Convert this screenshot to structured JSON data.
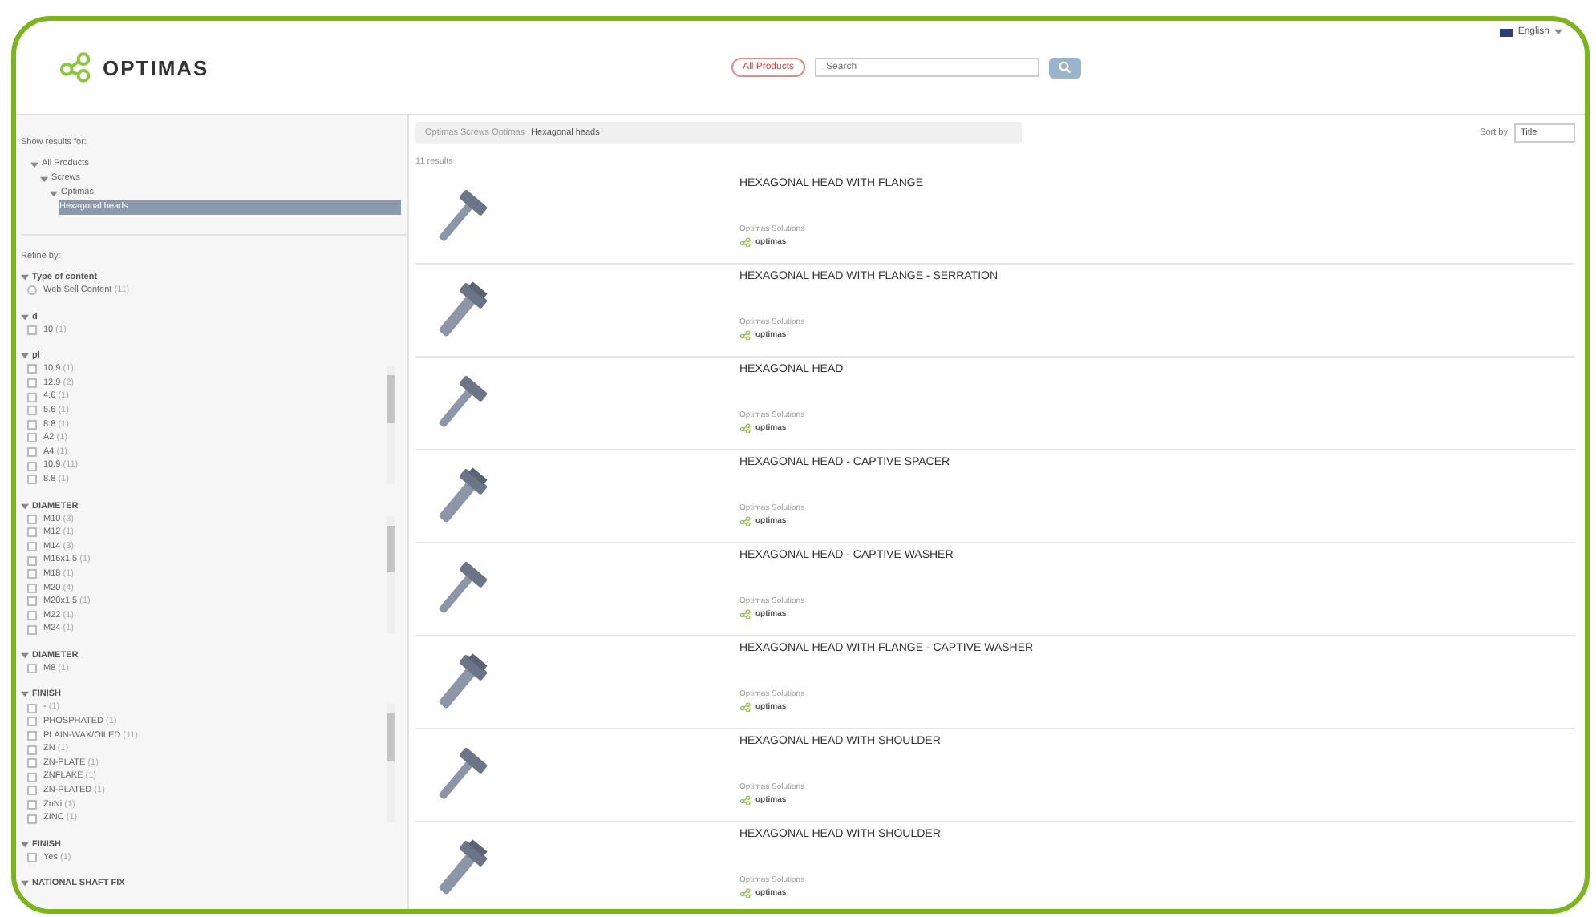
{
  "header": {
    "logo_text": "OPTIMAS",
    "search": {
      "scope": "All Products",
      "placeholder": "Search"
    },
    "language": "English"
  },
  "sidebar": {
    "show_results_label": "Show results for:",
    "tree": [
      {
        "label": "All Products",
        "selected": false,
        "children": [
          {
            "label": "Screws",
            "selected": false,
            "children": [
              {
                "label": "Optimas",
                "selected": false,
                "children": [
                  {
                    "label": "Hexagonal heads",
                    "selected": true
                  }
                ]
              }
            ]
          }
        ]
      }
    ],
    "refine_label": "Refine by:",
    "facets": [
      {
        "title": "Type of content",
        "kind": "radio",
        "items": [
          {
            "label": "Web Sell Content",
            "count": "(11)",
            "checked": false
          }
        ]
      },
      {
        "title": "d",
        "kind": "checkbox",
        "items": [
          {
            "label": "10",
            "count": "(1)",
            "checked": false
          }
        ]
      },
      {
        "title": "pl",
        "kind": "checkbox",
        "scrollable": true,
        "items": [
          {
            "label": "10.9",
            "count": "(1)",
            "checked": false
          },
          {
            "label": "12.9",
            "count": "(2)",
            "checked": false
          },
          {
            "label": "4.6",
            "count": "(1)",
            "checked": false
          },
          {
            "label": "5.6",
            "count": "(1)",
            "checked": false
          },
          {
            "label": "8.8",
            "count": "(1)",
            "checked": false
          },
          {
            "label": "A2",
            "count": "(1)",
            "checked": false
          },
          {
            "label": "A4",
            "count": "(1)",
            "checked": false
          },
          {
            "label": "10.9",
            "count": "(11)",
            "checked": false
          },
          {
            "label": "8.8",
            "count": "(1)",
            "checked": false
          }
        ]
      },
      {
        "title": "DIAMETER",
        "kind": "checkbox",
        "scrollable": true,
        "items": [
          {
            "label": "M10",
            "count": "(3)",
            "checked": false
          },
          {
            "label": "M12",
            "count": "(1)",
            "checked": false
          },
          {
            "label": "M14",
            "count": "(3)",
            "checked": false
          },
          {
            "label": "M16x1.5",
            "count": "(1)",
            "checked": false
          },
          {
            "label": "M18",
            "count": "(1)",
            "checked": false
          },
          {
            "label": "M20",
            "count": "(4)",
            "checked": false
          },
          {
            "label": "M20x1.5",
            "count": "(1)",
            "checked": false
          },
          {
            "label": "M22",
            "count": "(1)",
            "checked": false
          },
          {
            "label": "M24",
            "count": "(1)",
            "checked": false
          }
        ]
      },
      {
        "title": "DIAMETER",
        "kind": "checkbox",
        "items": [
          {
            "label": "M8",
            "count": "(1)",
            "checked": false
          }
        ]
      },
      {
        "title": "FINISH",
        "kind": "checkbox",
        "scrollable": true,
        "items": [
          {
            "label": "-",
            "count": "(1)",
            "checked": false
          },
          {
            "label": "PHOSPHATED",
            "count": "(1)",
            "checked": false
          },
          {
            "label": "PLAIN-WAX/OILED",
            "count": "(11)",
            "checked": false
          },
          {
            "label": "ZN",
            "count": "(1)",
            "checked": false
          },
          {
            "label": "ZN-PLATE",
            "count": "(1)",
            "checked": false
          },
          {
            "label": "ZNFLAKE",
            "count": "(1)",
            "checked": false
          },
          {
            "label": "ZN-PLATED",
            "count": "(1)",
            "checked": false
          },
          {
            "label": "ZnNi",
            "count": "(1)",
            "checked": false
          },
          {
            "label": "ZINC",
            "count": "(1)",
            "checked": false
          }
        ]
      },
      {
        "title": "FINISH",
        "kind": "checkbox",
        "items": [
          {
            "label": "Yes",
            "count": "(1)",
            "checked": false
          }
        ]
      },
      {
        "title": "NATIONAL SHAFT FIX"
      }
    ]
  },
  "main": {
    "breadcrumb": [
      "Optimas Screws Optimas",
      "Hexagonal heads"
    ],
    "sort_label": "Sort by",
    "sort_value": "Title",
    "results_count": "11 results",
    "products": [
      {
        "title": "HEXAGONAL HEAD WITH FLANGE",
        "supplier_label": "Optimas Solutions",
        "brand": "optimas"
      },
      {
        "title": "HEXAGONAL HEAD WITH FLANGE - SERRATION",
        "supplier_label": "Optimas Solutions",
        "brand": "optimas"
      },
      {
        "title": "HEXAGONAL HEAD",
        "supplier_label": "Optimas Solutions",
        "brand": "optimas"
      },
      {
        "title": "HEXAGONAL HEAD - CAPTIVE SPACER",
        "supplier_label": "Optimas Solutions",
        "brand": "optimas"
      },
      {
        "title": "HEXAGONAL HEAD - CAPTIVE WASHER",
        "supplier_label": "Optimas Solutions",
        "brand": "optimas"
      },
      {
        "title": "HEXAGONAL HEAD WITH FLANGE - CAPTIVE WASHER",
        "supplier_label": "Optimas Solutions",
        "brand": "optimas"
      },
      {
        "title": "HEXAGONAL HEAD WITH SHOULDER",
        "supplier_label": "Optimas Solutions",
        "brand": "optimas"
      },
      {
        "title": "HEXAGONAL HEAD WITH SHOULDER",
        "supplier_label": "Optimas Solutions",
        "brand": "optimas"
      }
    ]
  }
}
